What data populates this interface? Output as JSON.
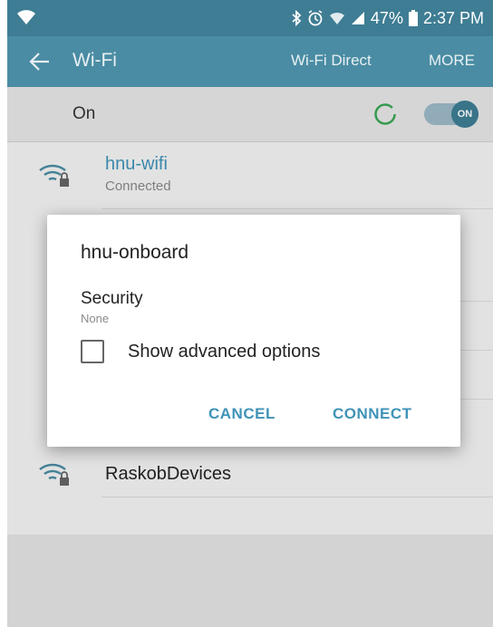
{
  "status_bar": {
    "battery": "47%",
    "time": "2:37 PM",
    "icons": [
      "wifi-signal-icon",
      "bluetooth-icon",
      "alarm-icon",
      "cell-signal-icon",
      "battery-icon"
    ]
  },
  "app_bar": {
    "title": "Wi-Fi",
    "actions": {
      "wifi_direct": "Wi-Fi Direct",
      "more": "MORE"
    }
  },
  "wifi_switch": {
    "label": "On",
    "toggle_text": "ON"
  },
  "networks": [
    {
      "name": "hnu-wifi",
      "status": "Connected"
    },
    {
      "name": "RaskobDevices",
      "status": ""
    }
  ],
  "dialog": {
    "title": "hnu-onboard",
    "security_label": "Security",
    "security_value": "None",
    "advanced_label": "Show advanced options",
    "advanced_checked": false,
    "cancel_label": "CANCEL",
    "connect_label": "CONNECT"
  },
  "colors": {
    "status_bar": "#3e7d94",
    "app_bar": "#4a8ca3",
    "accent": "#3f93b8",
    "spinner": "#3aa655"
  }
}
